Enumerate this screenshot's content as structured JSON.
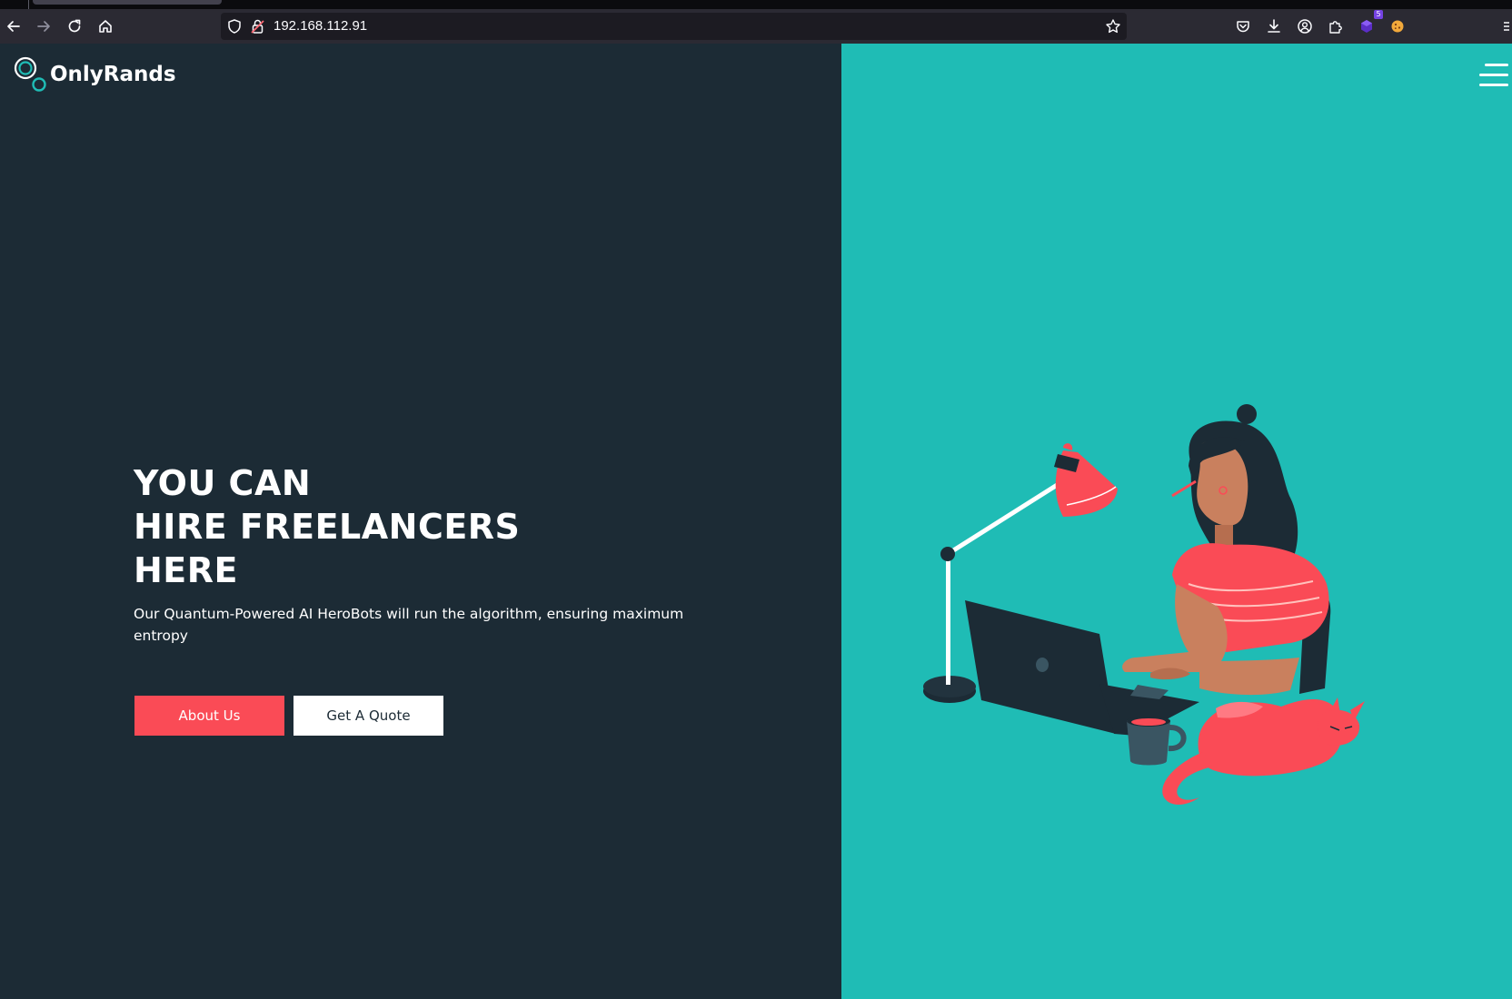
{
  "browser": {
    "url": "192.168.112.91",
    "extension_badge": "5"
  },
  "brand": {
    "name": "OnlyRands"
  },
  "hero": {
    "title_lines": [
      "YOU CAN",
      "HIRE FREELANCERS",
      "HERE"
    ],
    "subtitle": "Our Quantum-Powered AI HeroBots will run the algorithm, ensuring maximum entropy"
  },
  "buttons": {
    "about": "About Us",
    "quote": "Get A Quote"
  },
  "colors": {
    "dark_panel": "#1c2b35",
    "teal_panel": "#1fbcb5",
    "accent_red": "#fa4b56",
    "white": "#ffffff"
  },
  "icons": {
    "back": "arrow-left-icon",
    "forward": "arrow-right-icon",
    "reload": "reload-icon",
    "home": "home-icon",
    "tracking": "shield-icon",
    "insecure": "lock-warning-icon",
    "bookmark": "star-icon",
    "pocket": "pocket-icon",
    "downloads": "download-icon",
    "account": "account-icon",
    "extensions": "puzzle-icon",
    "menu": "hamburger-icon"
  }
}
